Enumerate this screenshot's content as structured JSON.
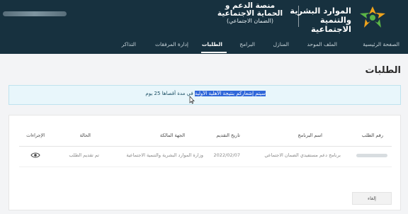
{
  "header": {
    "logo_text_line1": "الموارد البشرية",
    "logo_text_line2": "والتنمية الاجتماعية",
    "platform_line1": "منصة الدعم و",
    "platform_line2": "الحماية الاجتماعية",
    "platform_line3": "(الضمان الاجتماعي)"
  },
  "nav": {
    "items": [
      {
        "label": "الصفحة الرئيسية"
      },
      {
        "label": "الملف الموحد"
      },
      {
        "label": "المنازل"
      },
      {
        "label": "البرامج"
      },
      {
        "label": "الطلبات"
      },
      {
        "label": "إدارة المرفقات"
      },
      {
        "label": "التذاكر"
      }
    ],
    "active": "الطلبات"
  },
  "page": {
    "title": "الطلبات",
    "notice_highlight": "سيتم إشعاركم بنتيجة الأهلية الأولية",
    "notice_rest": " في مدة أقصاها 25 يوم"
  },
  "table": {
    "headers": [
      "رقم الطلب",
      "اسم البرنامج",
      "تاريخ التقديم",
      "الجهة المالكة",
      "الحالة",
      "الإجراءات"
    ],
    "rows": [
      {
        "program": "برنامج دعم مستفيدي الضمان الاجتماعي",
        "date": "2022/02/07",
        "owner": "وزارة الموارد البشرية والتنمية الاجتماعية",
        "status": "تم تقديم الطلب"
      }
    ]
  },
  "actions": {
    "cancel_label": "إلغاء"
  },
  "colors": {
    "header_bg": "#17313f",
    "notice_bg": "#e8f6fb",
    "highlight": "#2f66d9",
    "logo_orange": "#f0a31b",
    "logo_green": "#5bb547"
  }
}
